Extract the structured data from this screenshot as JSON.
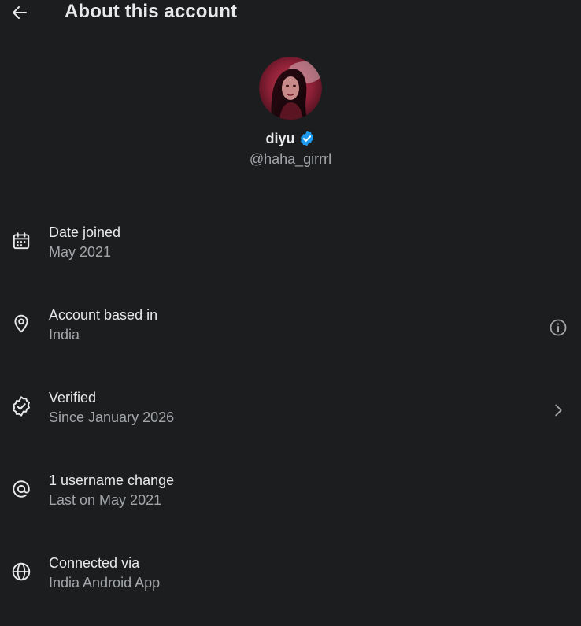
{
  "header": {
    "title": "About this account",
    "back_icon": "arrow-left-icon"
  },
  "profile": {
    "display_name": "diyu",
    "handle": "@haha_girrrl",
    "verified": true,
    "badge_color": "#1d9bf0",
    "avatar_icon": "profile-photo"
  },
  "rows": [
    {
      "icon": "calendar-icon",
      "label": "Date joined",
      "value": "May 2021",
      "action": null
    },
    {
      "icon": "location-pin-icon",
      "label": "Account based in",
      "value": "India",
      "action": "info-icon"
    },
    {
      "icon": "verified-check-icon",
      "label": "Verified",
      "value": "Since January 2026",
      "action": "chevron-right-icon"
    },
    {
      "icon": "at-sign-icon",
      "label": "1 username change",
      "value": "Last on May 2021",
      "action": null
    },
    {
      "icon": "globe-icon",
      "label": "Connected via",
      "value": "India Android App",
      "action": null
    }
  ],
  "colors": {
    "background": "#1c1d1f",
    "primary_text": "#e7e9ea",
    "secondary_text": "#a3a6a9",
    "accent": "#1d9bf0"
  }
}
